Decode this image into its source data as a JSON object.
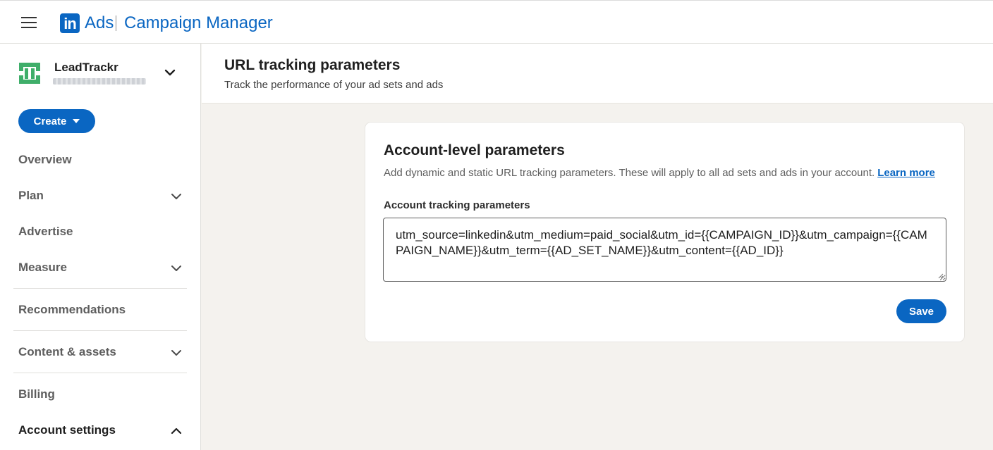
{
  "app": {
    "brand_short": "in",
    "brand_product": "Ads",
    "brand_title": "Campaign Manager",
    "accent_color": "#0a66c2"
  },
  "account": {
    "name": "LeadTrackr",
    "logo_color": "#3fae6a"
  },
  "sidebar": {
    "create_label": "Create",
    "items": [
      {
        "label": "Overview",
        "has_chevron": false
      },
      {
        "label": "Plan",
        "has_chevron": true,
        "chevron": "chevron-down-icon"
      },
      {
        "label": "Advertise",
        "has_chevron": false
      },
      {
        "label": "Measure",
        "has_chevron": true,
        "chevron": "chevron-down-icon"
      },
      {
        "label": "Recommendations",
        "has_chevron": false
      },
      {
        "label": "Content & assets",
        "has_chevron": true,
        "chevron": "chevron-down-icon"
      },
      {
        "label": "Billing",
        "has_chevron": false
      },
      {
        "label": "Account settings",
        "has_chevron": true,
        "chevron": "chevron-up-icon",
        "expanded": true
      }
    ]
  },
  "header": {
    "title": "URL tracking parameters",
    "subtitle": "Track the performance of your ad sets and ads"
  },
  "card": {
    "title": "Account-level parameters",
    "description": "Add dynamic and static URL tracking parameters. These will apply to all ad sets and ads in your account.",
    "learn_more": "Learn more",
    "field_label": "Account tracking parameters",
    "field_value": "utm_source=linkedin&utm_medium=paid_social&utm_id={{CAMPAIGN_ID}}&utm_campaign={{CAMPAIGN_NAME}}&utm_term={{AD_SET_NAME}}&utm_content={{AD_ID}}",
    "save_label": "Save"
  }
}
